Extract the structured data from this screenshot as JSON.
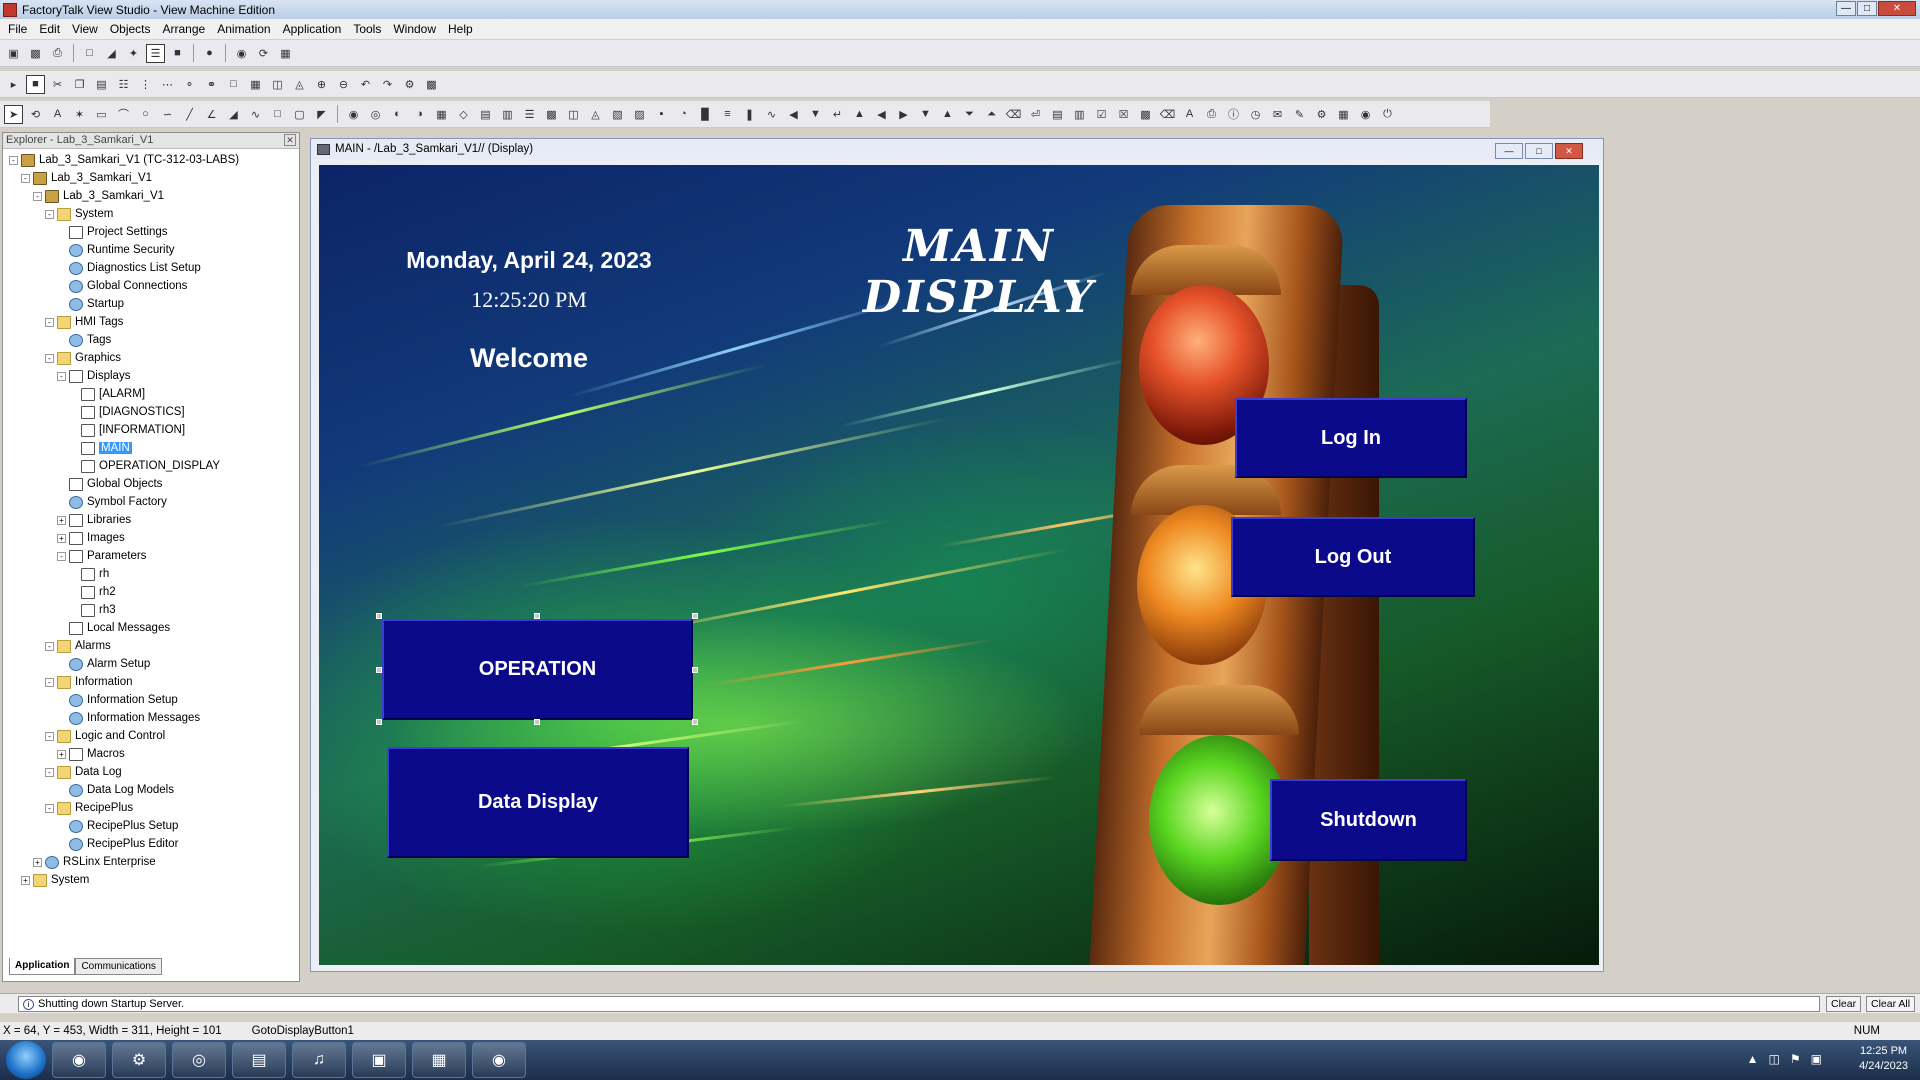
{
  "window": {
    "title": "FactoryTalk View Studio - View Machine Edition"
  },
  "menu": [
    "File",
    "Edit",
    "View",
    "Objects",
    "Arrange",
    "Animation",
    "Application",
    "Tools",
    "Window",
    "Help"
  ],
  "explorer": {
    "title": "Explorer - Lab_3_Samkari_V1",
    "tabs": {
      "application": "Application",
      "communications": "Communications"
    },
    "tree": [
      {
        "label": "Lab_3_Samkari_V1 (TC-312-03-LABS)",
        "level": 0,
        "exp": "-",
        "icon": "proj"
      },
      {
        "label": "Lab_3_Samkari_V1",
        "level": 1,
        "exp": "-",
        "icon": "proj"
      },
      {
        "label": "Lab_3_Samkari_V1",
        "level": 2,
        "exp": "-",
        "icon": "proj"
      },
      {
        "label": "System",
        "level": 3,
        "exp": "-",
        "icon": "folder"
      },
      {
        "label": "Project Settings",
        "level": 4,
        "exp": "",
        "icon": "page"
      },
      {
        "label": "Runtime Security",
        "level": 4,
        "exp": "",
        "icon": "gear"
      },
      {
        "label": "Diagnostics List Setup",
        "level": 4,
        "exp": "",
        "icon": "gear"
      },
      {
        "label": "Global Connections",
        "level": 4,
        "exp": "",
        "icon": "gear"
      },
      {
        "label": "Startup",
        "level": 4,
        "exp": "",
        "icon": "gear"
      },
      {
        "label": "HMI Tags",
        "level": 3,
        "exp": "-",
        "icon": "folder"
      },
      {
        "label": "Tags",
        "level": 4,
        "exp": "",
        "icon": "gear"
      },
      {
        "label": "Graphics",
        "level": 3,
        "exp": "-",
        "icon": "folder"
      },
      {
        "label": "Displays",
        "level": 4,
        "exp": "-",
        "icon": "page"
      },
      {
        "label": "[ALARM]",
        "level": 5,
        "exp": "",
        "icon": "page"
      },
      {
        "label": "[DIAGNOSTICS]",
        "level": 5,
        "exp": "",
        "icon": "page"
      },
      {
        "label": "[INFORMATION]",
        "level": 5,
        "exp": "",
        "icon": "page"
      },
      {
        "label": "MAIN",
        "level": 5,
        "exp": "",
        "icon": "page",
        "selected": true
      },
      {
        "label": "OPERATION_DISPLAY",
        "level": 5,
        "exp": "",
        "icon": "page"
      },
      {
        "label": "Global Objects",
        "level": 4,
        "exp": "",
        "icon": "page"
      },
      {
        "label": "Symbol Factory",
        "level": 4,
        "exp": "",
        "icon": "gear"
      },
      {
        "label": "Libraries",
        "level": 4,
        "exp": "+",
        "icon": "page"
      },
      {
        "label": "Images",
        "level": 4,
        "exp": "+",
        "icon": "page"
      },
      {
        "label": "Parameters",
        "level": 4,
        "exp": "-",
        "icon": "page"
      },
      {
        "label": "rh",
        "level": 5,
        "exp": "",
        "icon": "page"
      },
      {
        "label": "rh2",
        "level": 5,
        "exp": "",
        "icon": "page"
      },
      {
        "label": "rh3",
        "level": 5,
        "exp": "",
        "icon": "page"
      },
      {
        "label": "Local Messages",
        "level": 4,
        "exp": "",
        "icon": "page"
      },
      {
        "label": "Alarms",
        "level": 3,
        "exp": "-",
        "icon": "folder"
      },
      {
        "label": "Alarm Setup",
        "level": 4,
        "exp": "",
        "icon": "gear"
      },
      {
        "label": "Information",
        "level": 3,
        "exp": "-",
        "icon": "folder"
      },
      {
        "label": "Information Setup",
        "level": 4,
        "exp": "",
        "icon": "gear"
      },
      {
        "label": "Information Messages",
        "level": 4,
        "exp": "",
        "icon": "gear"
      },
      {
        "label": "Logic and Control",
        "level": 3,
        "exp": "-",
        "icon": "folder"
      },
      {
        "label": "Macros",
        "level": 4,
        "exp": "+",
        "icon": "page"
      },
      {
        "label": "Data Log",
        "level": 3,
        "exp": "-",
        "icon": "folder"
      },
      {
        "label": "Data Log Models",
        "level": 4,
        "exp": "",
        "icon": "gear"
      },
      {
        "label": "RecipePlus",
        "level": 3,
        "exp": "-",
        "icon": "folder"
      },
      {
        "label": "RecipePlus Setup",
        "level": 4,
        "exp": "",
        "icon": "gear"
      },
      {
        "label": "RecipePlus Editor",
        "level": 4,
        "exp": "",
        "icon": "gear"
      },
      {
        "label": "RSLinx Enterprise",
        "level": 2,
        "exp": "+",
        "icon": "gear"
      },
      {
        "label": "System",
        "level": 1,
        "exp": "+",
        "icon": "folder"
      }
    ]
  },
  "display_window": {
    "title": "MAIN - /Lab_3_Samkari_V1// (Display)"
  },
  "display": {
    "date": "Monday, April 24, 2023",
    "time": "12:25:20 PM",
    "welcome": "Welcome",
    "heading": "MAIN DISPLAY",
    "buttons": {
      "operation": "OPERATION",
      "data_display": "Data Display",
      "log_in": "Log In",
      "log_out": "Log Out",
      "shutdown": "Shutdown"
    }
  },
  "messages": {
    "text": "Shutting down Startup Server.",
    "clear": "Clear",
    "clear_all": "Clear All"
  },
  "statusbar": {
    "coords": "X = 64, Y = 453, Width = 311, Height = 101",
    "object": "GotoDisplayButton1",
    "num": "NUM"
  },
  "taskbar": {
    "time": "12:25 PM",
    "date": "4/24/2023"
  }
}
